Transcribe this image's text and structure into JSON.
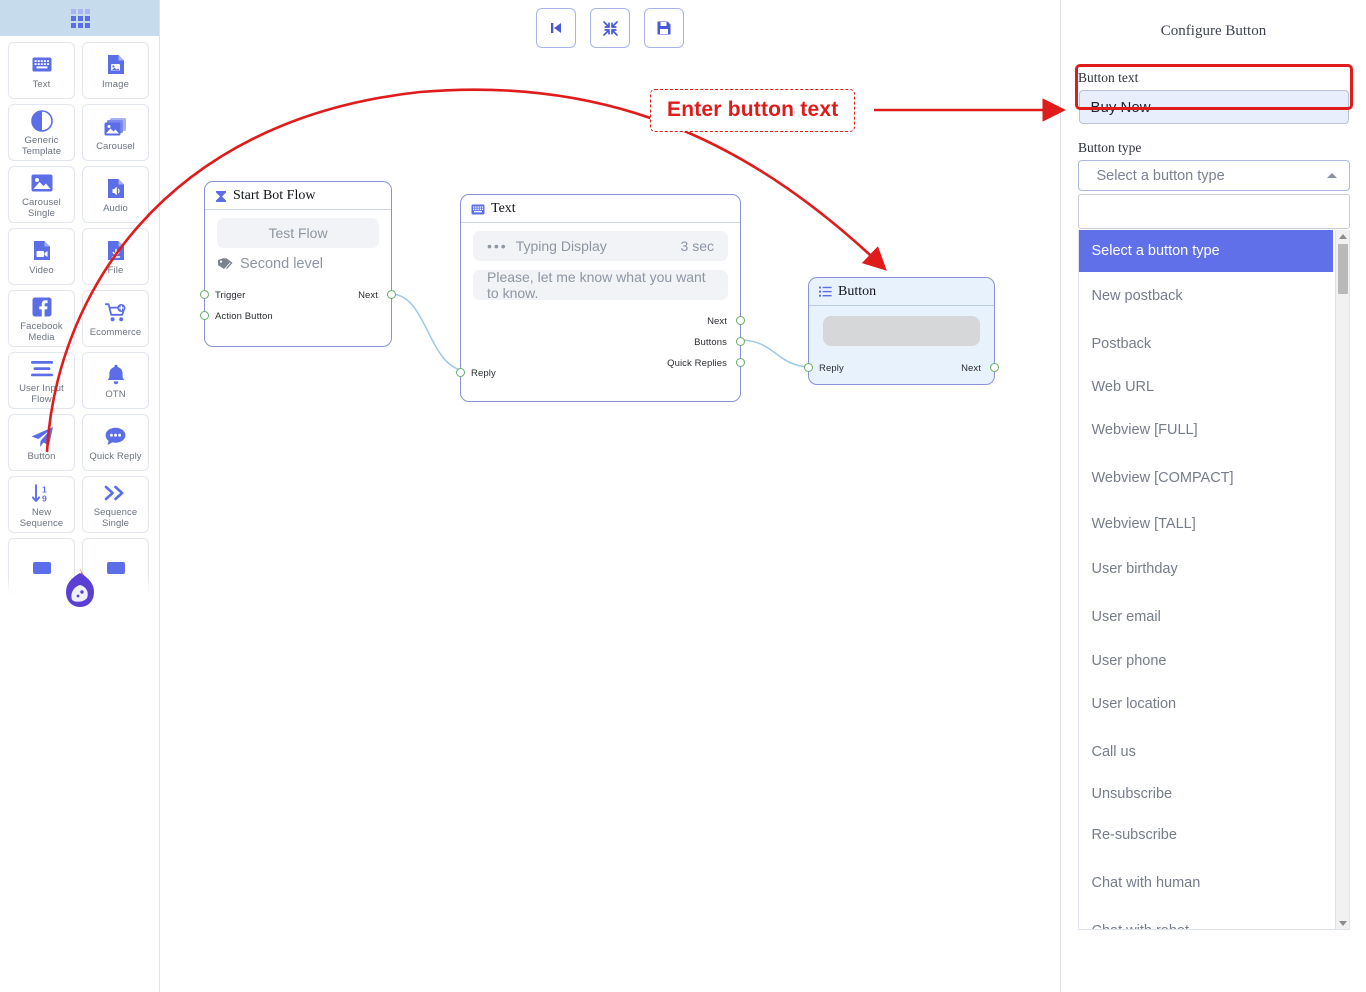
{
  "sidebar": {
    "header_icon": "apps-grid-icon",
    "items": [
      {
        "label": "Text",
        "icon": "keyboard-icon"
      },
      {
        "label": "Image",
        "icon": "image-file-icon"
      },
      {
        "label": "Generic Template",
        "icon": "contrast-circle-icon"
      },
      {
        "label": "Carousel",
        "icon": "carousel-images-icon"
      },
      {
        "label": "Carousel Single",
        "icon": "single-image-icon"
      },
      {
        "label": "Audio",
        "icon": "audio-file-icon"
      },
      {
        "label": "Video",
        "icon": "video-file-icon"
      },
      {
        "label": "File",
        "icon": "download-file-icon"
      },
      {
        "label": "Facebook Media",
        "icon": "facebook-icon"
      },
      {
        "label": "Ecommerce",
        "icon": "shopping-cart-icon"
      },
      {
        "label": "User Input Flow",
        "icon": "lines-list-icon"
      },
      {
        "label": "OTN",
        "icon": "bell-icon"
      },
      {
        "label": "Button",
        "icon": "paper-plane-icon"
      },
      {
        "label": "Quick Reply",
        "icon": "chat-bubble-icon"
      },
      {
        "label": "New Sequence",
        "icon": "sort-numeric-icon"
      },
      {
        "label": "Sequence Single",
        "icon": "double-chevron-right-icon"
      }
    ],
    "logo_icon": "flame-chat-logo"
  },
  "toolbar": {
    "buttons": [
      {
        "name": "back-to-start-button",
        "icon": "skip-backward-icon"
      },
      {
        "name": "fit-to-screen-button",
        "icon": "collapse-arrows-icon"
      },
      {
        "name": "save-button",
        "icon": "floppy-disk-icon"
      }
    ]
  },
  "annotation": {
    "callout_text": "Enter button text",
    "color": "#e01b1b"
  },
  "canvas": {
    "nodes": [
      {
        "title": "Start Bot Flow",
        "icon": "hourglass-icon",
        "action_label": "Test Flow",
        "tag_label": "Second level",
        "tag_icon": "tag-icon",
        "ports_left": [
          "Trigger",
          "Action Button"
        ],
        "ports_right": [
          "Next"
        ]
      },
      {
        "title": "Text",
        "icon": "keyboard-icon",
        "typing_label": "Typing Display",
        "typing_value": "3 sec",
        "message": "Please, let me know what you want to know.",
        "ports_left": [
          "Reply"
        ],
        "ports_right": [
          "Next",
          "Buttons",
          "Quick Replies"
        ]
      },
      {
        "title": "Button",
        "icon": "list-icon",
        "ports_left": [
          "Reply"
        ],
        "ports_right": [
          "Next"
        ]
      }
    ]
  },
  "panel": {
    "title": "Configure Button",
    "button_text": {
      "label": "Button text",
      "value": "Buy Now",
      "placeholder": "Button text"
    },
    "button_type": {
      "label": "Button type",
      "selected": "Select a button type",
      "caret_icon": "caret-up-icon",
      "search_value": "",
      "search_placeholder": "",
      "options": [
        "Select a button type",
        "New postback",
        "Postback",
        "Web URL",
        "Webview [FULL]",
        "Webview [COMPACT]",
        "Webview [TALL]",
        "User birthday",
        "User email",
        "User phone",
        "User location",
        "Call us",
        "Unsubscribe",
        "Re-subscribe",
        "Chat with human",
        "Chat with robot"
      ],
      "selected_index": 0
    }
  },
  "colors": {
    "accent": "#5b6ee8",
    "highlight": "#6070e8",
    "annotation_red": "#e01b1b",
    "node_border": "#8a93d6",
    "port_green": "#6aab6a"
  }
}
